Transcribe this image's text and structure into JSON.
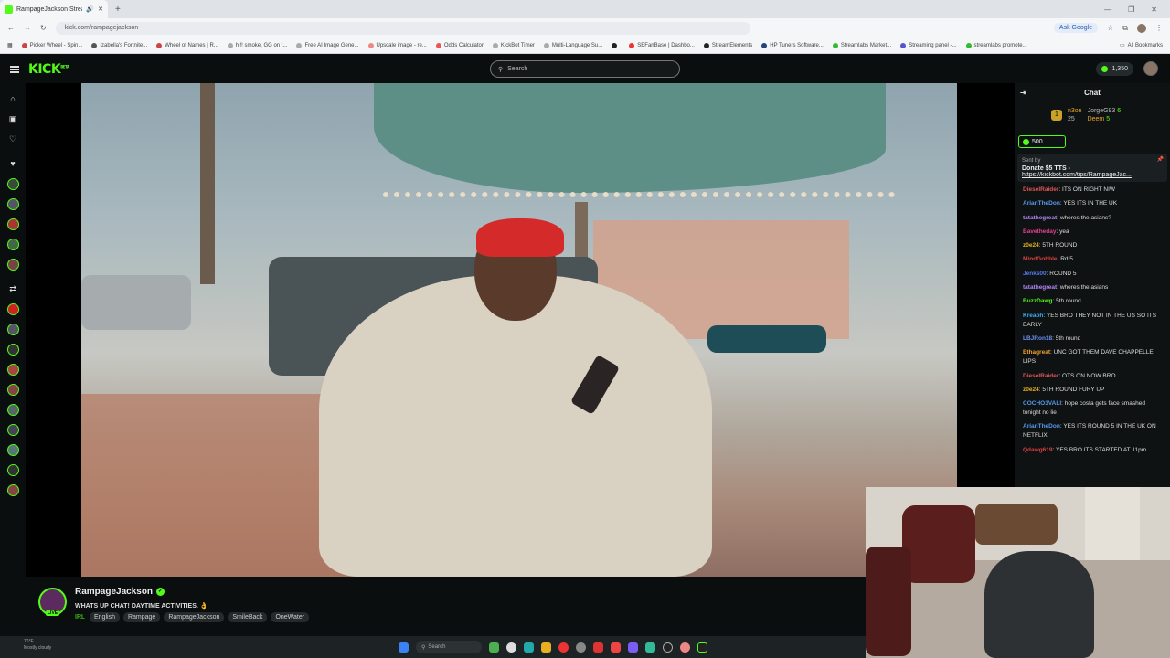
{
  "browser": {
    "tab_title": "RampageJackson Stream - ",
    "url": "kick.com/rampagejackson",
    "ask_google": "Ask Google",
    "new_tab": "+",
    "bookmarks": [
      "Picker Wheel - Spin...",
      "Izabella's Fortnite...",
      "Wheel of Names | R...",
      "hi!! smoke, GG on t...",
      "Free AI Image Gene...",
      "Upscale image - re...",
      "Odds Calculator",
      "KickBot Timer",
      "Multi-Language Su...",
      "",
      "SEFanBase | Dashbo...",
      "StreamElements",
      "HP Tuners Software...",
      "Streamlabs Market...",
      "Streaming panel -...",
      "streamlabs promote..."
    ],
    "all_bookmarks": "All Bookmarks"
  },
  "header": {
    "logo": "KICK",
    "logo_sup": "BETA",
    "search_placeholder": "Search",
    "kicks_count": "1,350"
  },
  "rail": {
    "icons": [
      "home-icon",
      "browse-icon",
      "following-icon"
    ],
    "section_icon": "heart-icon",
    "recommended_icon": "arrows-icon"
  },
  "stream": {
    "streamer": "RampageJackson",
    "live_label": "LIVE",
    "title": "WHATS UP CHAT! DAYTIME ACTIVITIES. 👌",
    "category": "IRL",
    "tags": [
      "English",
      "Rampage",
      "RampageJackson",
      "SmileBack",
      "OneWater"
    ]
  },
  "chat": {
    "title": "Chat",
    "leaderboard": [
      {
        "rank_label": "n3on",
        "count": ""
      },
      {
        "rank_label": "JorgeG93",
        "count": "6"
      },
      {
        "rank_label": "25",
        "count": ""
      },
      {
        "rank_label": "Deem",
        "count": "5"
      }
    ],
    "kicks_badge": "500",
    "pinned": {
      "sent_by": "Sent by",
      "line1": "Donate $5 TTS -",
      "line2": "https://kickbot.com/tips/RampageJac..."
    },
    "messages": [
      {
        "user": "DieselRaider",
        "color": "#e05555",
        "text": "ITS ON RIGHT NIW"
      },
      {
        "user": "ArianTheDon",
        "color": "#5599ee",
        "text": "YES ITS IN THE UK"
      },
      {
        "user": "tatathegreat",
        "color": "#b084f5",
        "text": "wheres the asians?"
      },
      {
        "user": "Bavetheday",
        "color": "#e04090",
        "text": "yea"
      },
      {
        "user": "z0e24",
        "color": "#e8b020",
        "text": "5TH ROUND"
      },
      {
        "user": "MindGobble",
        "color": "#e04040",
        "text": "Rd 5"
      },
      {
        "user": "Jenks00",
        "color": "#5577ee",
        "text": "ROUND 5"
      },
      {
        "user": "tatathegreat",
        "color": "#b084f5",
        "text": "wheres the asians"
      },
      {
        "user": "BuzzDawg",
        "color": "#53fc18",
        "text": "5th round"
      },
      {
        "user": "Kreaoh",
        "color": "#3fa9f5",
        "text": "YES BRO THEY NOT IN THE US SO ITS EARLY"
      },
      {
        "user": "LBJRon18",
        "color": "#6b8ff5",
        "text": "5th round"
      },
      {
        "user": "Ethagreat",
        "color": "#f0a030",
        "text": "UNC GOT THEM DAVE CHAPPELLE LIPS"
      },
      {
        "user": "DieselRaider",
        "color": "#e05555",
        "text": "OTS ON NOW BRO"
      },
      {
        "user": "z0e24",
        "color": "#e8b020",
        "text": "5TH ROUND FURY UP"
      },
      {
        "user": "COCHO3VALI",
        "color": "#5599ee",
        "text": "hope costa gets face smashed tonight no lie"
      },
      {
        "user": "ArianTheDon",
        "color": "#5599ee",
        "text": "YES ITS ROUND 5 IN THE UK ON NETFLIX"
      },
      {
        "user": "Qdawg619",
        "color": "#e04040",
        "text": "YES BRO ITS STARTED AT 11pm"
      }
    ]
  },
  "taskbar": {
    "temp": "76°F",
    "weather": "Mostly cloudy",
    "search": "Search"
  }
}
